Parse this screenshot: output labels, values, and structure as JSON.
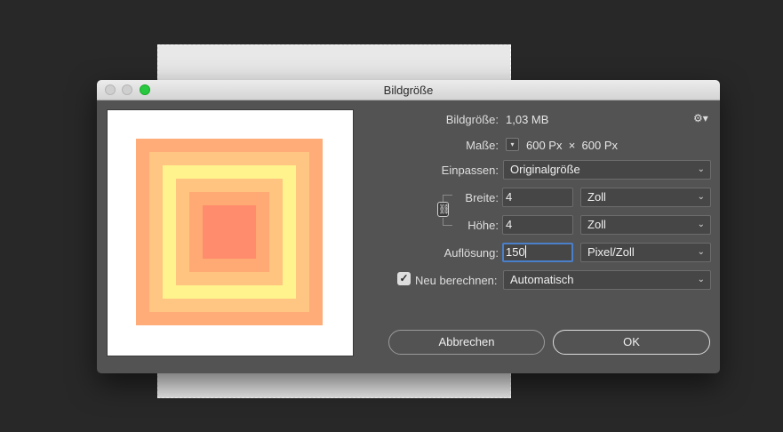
{
  "dialog": {
    "title": "Bildgröße",
    "settings_icon": "gear-icon"
  },
  "info": {
    "size_label": "Bildgröße:",
    "size_value": "1,03 MB",
    "dims_label": "Maße:",
    "dims_value": "600 Px  ×  600 Px"
  },
  "fit": {
    "label": "Einpassen:",
    "value": "Originalgröße"
  },
  "width": {
    "label": "Breite:",
    "value": "4",
    "unit": "Zoll"
  },
  "height": {
    "label": "Höhe:",
    "value": "4",
    "unit": "Zoll"
  },
  "resolution": {
    "label": "Auflösung:",
    "value": "150",
    "unit": "Pixel/Zoll"
  },
  "resample": {
    "checked": true,
    "label": "Neu berechnen:",
    "value": "Automatisch"
  },
  "buttons": {
    "cancel": "Abbrechen",
    "ok": "OK"
  },
  "preview": {
    "colors": [
      "#ffac78",
      "#ffc582",
      "#fff38d",
      "#ffc480",
      "#ffaa74",
      "#ff8c6c"
    ]
  }
}
